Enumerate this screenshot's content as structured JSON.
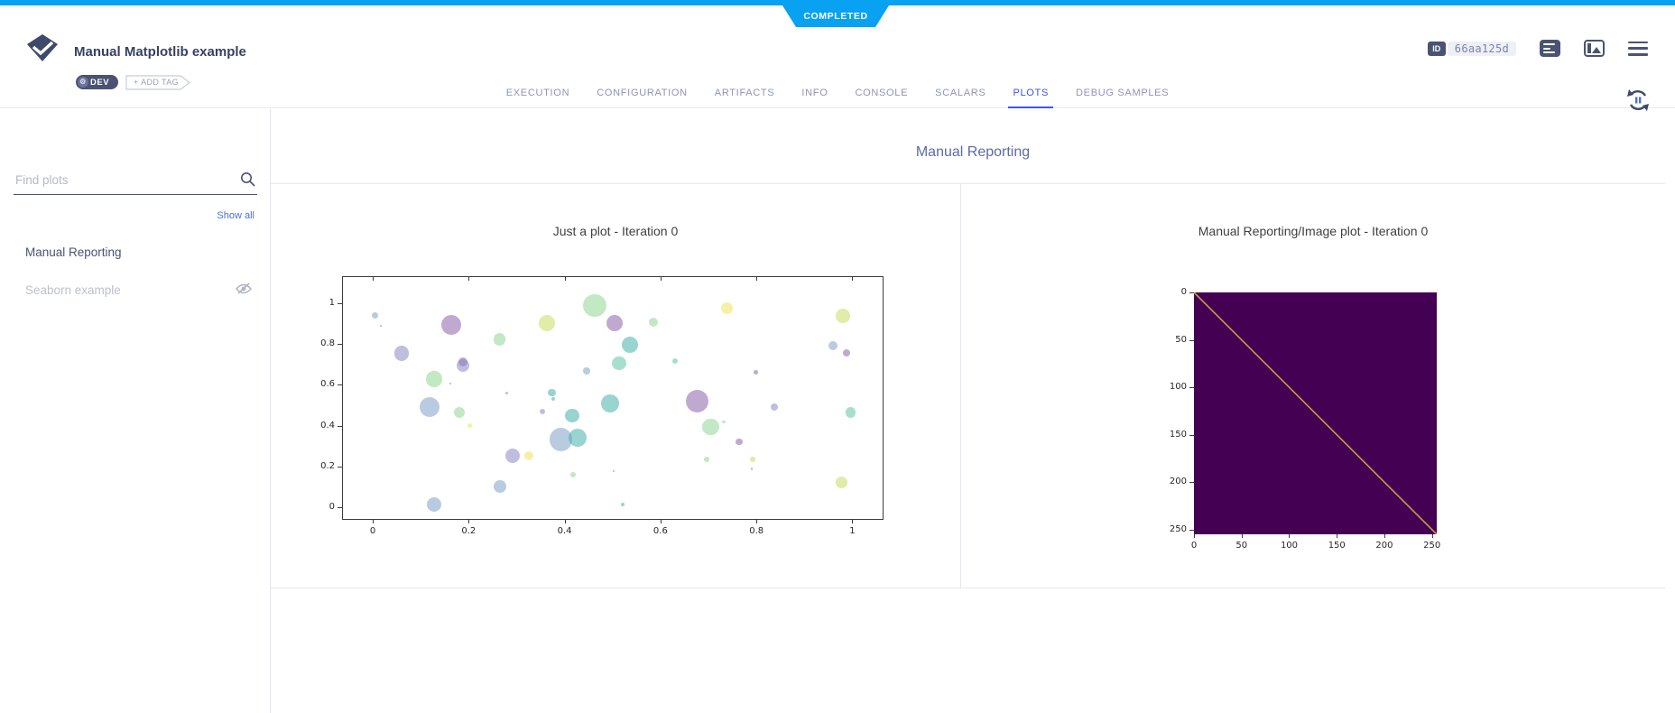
{
  "colors": {
    "accent_blue": "#09a1f1",
    "slate": "#4a5373",
    "title_text": "#384161",
    "active_tab": "#4253e8",
    "group_title": "#5c6aa6",
    "divider": "#e3e7ef"
  },
  "ribbon": {
    "status": "COMPLETED"
  },
  "header": {
    "title": "Manual Matplotlib example",
    "dev_tag": "DEV",
    "add_tag": "+ ADD TAG",
    "id_label": "ID",
    "id_value": "66aa125d"
  },
  "tabs": [
    {
      "label": "EXECUTION",
      "active": false
    },
    {
      "label": "CONFIGURATION",
      "active": false
    },
    {
      "label": "ARTIFACTS",
      "active": false
    },
    {
      "label": "INFO",
      "active": false
    },
    {
      "label": "CONSOLE",
      "active": false
    },
    {
      "label": "SCALARS",
      "active": false
    },
    {
      "label": "PLOTS",
      "active": true
    },
    {
      "label": "DEBUG SAMPLES",
      "active": false
    }
  ],
  "sidebar": {
    "search_placeholder": "Find plots",
    "show_all": "Show all",
    "items": [
      {
        "label": "Manual Reporting",
        "dimmed": false,
        "hidden_icon": false
      },
      {
        "label": "Seaborn example",
        "dimmed": true,
        "hidden_icon": true
      }
    ]
  },
  "main": {
    "group_title": "Manual Reporting"
  },
  "chart_data": [
    {
      "type": "scatter",
      "title": "Just a plot - Iteration 0",
      "xlabel": "",
      "ylabel": "",
      "xlim": [
        -0.064,
        1.065
      ],
      "ylim": [
        -0.0625,
        1.133
      ],
      "xticks": [
        0,
        0.2,
        0.4,
        0.6,
        0.8,
        1
      ],
      "yticks": [
        0,
        0.2,
        0.4,
        0.6,
        0.8,
        1
      ],
      "grid": false,
      "palette": {
        "p": "#8a63ab",
        "l": "#8a88c7",
        "b": "#7fa1c9",
        "t": "#43b0aa",
        "m": "#5fc4a6",
        "g": "#8fd693",
        "yg": "#c6dc61",
        "y": "#ede35c"
      },
      "points": [
        {
          "x": 0.002,
          "y": 0.944,
          "r": 3.5,
          "c": "b"
        },
        {
          "x": 0.015,
          "y": 0.895,
          "r": 1.2,
          "c": "p"
        },
        {
          "x": 0.162,
          "y": 0.9,
          "r": 11,
          "c": "p"
        },
        {
          "x": 0.058,
          "y": 0.758,
          "r": 8.3,
          "c": "l"
        },
        {
          "x": 0.187,
          "y": 0.718,
          "r": 5,
          "c": "p"
        },
        {
          "x": 0.186,
          "y": 0.7,
          "r": 7,
          "c": "l"
        },
        {
          "x": 0.263,
          "y": 0.828,
          "r": 6.7,
          "c": "g"
        },
        {
          "x": 0.126,
          "y": 0.633,
          "r": 8.7,
          "c": "g"
        },
        {
          "x": 0.16,
          "y": 0.61,
          "r": 1.2,
          "c": "p"
        },
        {
          "x": 0.116,
          "y": 0.495,
          "r": 11,
          "c": "b"
        },
        {
          "x": 0.178,
          "y": 0.469,
          "r": 6,
          "c": "g"
        },
        {
          "x": 0.2,
          "y": 0.403,
          "r": 2.5,
          "c": "y"
        },
        {
          "x": 0.361,
          "y": 0.906,
          "r": 9,
          "c": "yg"
        },
        {
          "x": 0.461,
          "y": 0.995,
          "r": 12.7,
          "c": "g"
        },
        {
          "x": 0.503,
          "y": 0.908,
          "r": 9,
          "c": "p"
        },
        {
          "x": 0.583,
          "y": 0.911,
          "r": 5,
          "c": "g"
        },
        {
          "x": 0.534,
          "y": 0.8,
          "r": 9,
          "c": "t"
        },
        {
          "x": 0.512,
          "y": 0.711,
          "r": 7.7,
          "c": "m"
        },
        {
          "x": 0.444,
          "y": 0.673,
          "r": 3.7,
          "c": "b"
        },
        {
          "x": 0.629,
          "y": 0.723,
          "r": 3,
          "c": "m"
        },
        {
          "x": 0.372,
          "y": 0.566,
          "r": 4.3,
          "c": "t"
        },
        {
          "x": 0.374,
          "y": 0.536,
          "r": 2.3,
          "c": "t"
        },
        {
          "x": 0.277,
          "y": 0.564,
          "r": 1.7,
          "c": "l"
        },
        {
          "x": 0.351,
          "y": 0.472,
          "r": 3,
          "c": "l"
        },
        {
          "x": 0.414,
          "y": 0.453,
          "r": 7.7,
          "c": "t"
        },
        {
          "x": 0.492,
          "y": 0.513,
          "r": 10,
          "c": "t"
        },
        {
          "x": 0.39,
          "y": 0.336,
          "r": 12.7,
          "c": "b"
        },
        {
          "x": 0.426,
          "y": 0.344,
          "r": 10,
          "c": "t"
        },
        {
          "x": 0.29,
          "y": 0.258,
          "r": 8,
          "c": "l"
        },
        {
          "x": 0.323,
          "y": 0.255,
          "r": 5,
          "c": "y"
        },
        {
          "x": 0.416,
          "y": 0.164,
          "r": 3.3,
          "c": "g"
        },
        {
          "x": 0.501,
          "y": 0.181,
          "r": 1.2,
          "c": "p"
        },
        {
          "x": 0.263,
          "y": 0.105,
          "r": 7.3,
          "c": "b"
        },
        {
          "x": 0.126,
          "y": 0.017,
          "r": 8.3,
          "c": "b"
        },
        {
          "x": 0.519,
          "y": 0.017,
          "r": 2.3,
          "c": "t"
        },
        {
          "x": 0.675,
          "y": 0.523,
          "r": 12.7,
          "c": "p"
        },
        {
          "x": 0.703,
          "y": 0.398,
          "r": 9.3,
          "c": "g"
        },
        {
          "x": 0.73,
          "y": 0.422,
          "r": 1.7,
          "c": "g"
        },
        {
          "x": 0.736,
          "y": 0.98,
          "r": 6.7,
          "c": "y"
        },
        {
          "x": 0.762,
          "y": 0.325,
          "r": 3.7,
          "c": "p"
        },
        {
          "x": 0.694,
          "y": 0.239,
          "r": 3.3,
          "c": "g"
        },
        {
          "x": 0.79,
          "y": 0.239,
          "r": 2.7,
          "c": "yg"
        },
        {
          "x": 0.789,
          "y": 0.192,
          "r": 1.2,
          "c": "t"
        },
        {
          "x": 0.797,
          "y": 0.667,
          "r": 2.7,
          "c": "p"
        },
        {
          "x": 0.835,
          "y": 0.495,
          "r": 4,
          "c": "l"
        },
        {
          "x": 0.978,
          "y": 0.942,
          "r": 8.3,
          "c": "yg"
        },
        {
          "x": 0.958,
          "y": 0.797,
          "r": 5.3,
          "c": "b"
        },
        {
          "x": 0.986,
          "y": 0.761,
          "r": 4.3,
          "c": "p"
        },
        {
          "x": 0.995,
          "y": 0.469,
          "r": 5.7,
          "c": "m"
        },
        {
          "x": 0.975,
          "y": 0.125,
          "r": 6.7,
          "c": "yg"
        }
      ]
    },
    {
      "type": "heatmap",
      "title": "Manual Reporting/Image plot - Iteration 0",
      "extent": [
        0,
        255
      ],
      "xticks": [
        0,
        50,
        100,
        150,
        200,
        250
      ],
      "yticks": [
        0,
        50,
        100,
        150,
        200,
        250
      ],
      "background_color": "#440154",
      "diagonal_color": "#c59d3e",
      "description": "identity-matrix image: dark purple field with yellow diagonal from (0,0) to (255,255)"
    }
  ]
}
